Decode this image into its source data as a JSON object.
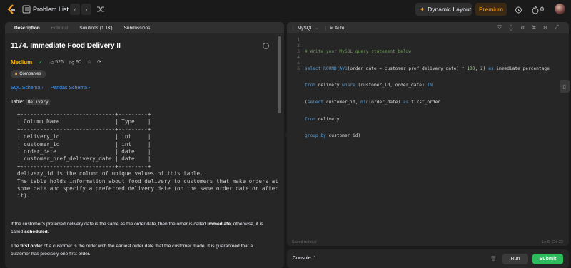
{
  "topbar": {
    "problem_list": "Problem List",
    "dynamic_layout": "Dynamic Layout",
    "premium": "Premium",
    "streak_count": "0"
  },
  "left": {
    "tabs": [
      {
        "label": "Description"
      },
      {
        "label": "Editorial"
      },
      {
        "label": "Solutions (1.1K)"
      },
      {
        "label": "Submissions"
      }
    ],
    "title": "1174. Immediate Food Delivery II",
    "difficulty": "Medium",
    "likes": "526",
    "dislikes": "90",
    "companies": "Companies",
    "links": [
      "SQL Schema",
      "Pandas Schema"
    ],
    "table_label": "Table:",
    "table_name": "Delivery",
    "schema_text": "+-----------------------------+---------+\n| Column Name                 | Type    |\n+-----------------------------+---------+\n| delivery_id                 | int     |\n| customer_id                 | int     |\n| order_date                  | date    |\n| customer_pref_delivery_date | date    |\n+-----------------------------+---------+\ndelivery_id is the column of unique values of this table.\nThe table holds information about food delivery to customers that make orders at\nsome date and specify a preferred delivery date (on the same order date or after\nit).",
    "para1_a": "If the customer's preferred delivery date is the same as the order date, then the order is called ",
    "para1_b": "immediate",
    "para1_c": "; otherwise, it is called ",
    "para1_d": "scheduled",
    "para1_e": ".",
    "para2_a": "The ",
    "para2_b": "first order",
    "para2_c": " of a customer is the order with the earliest order date that the customer made. It is guaranteed that a customer has precisely one first order."
  },
  "editor": {
    "language": "MySQL",
    "auto": "Auto",
    "line_numbers": [
      "1",
      "2",
      "3",
      "4",
      "5",
      "6"
    ],
    "lines": [
      "# Write your MySQL query statement below",
      "select ROUND(AVG(order_date = customer_pref_delivery_date) * 100, 2) as immediate_percentage",
      "from delivery where (customer_id, order_date) IN",
      "(select customer_id, min(order_date) as first_order",
      "from delivery",
      "group by customer_id)"
    ],
    "saved": "Saved to local",
    "cursor": "Ln 6, Col 22"
  },
  "console": {
    "label": "Console",
    "run": "Run",
    "submit": "Submit"
  },
  "colors": {
    "accent_green": "#2cbb5d",
    "medium": "#ffb800",
    "premium": "#ffa116",
    "link": "#3f99ff"
  }
}
